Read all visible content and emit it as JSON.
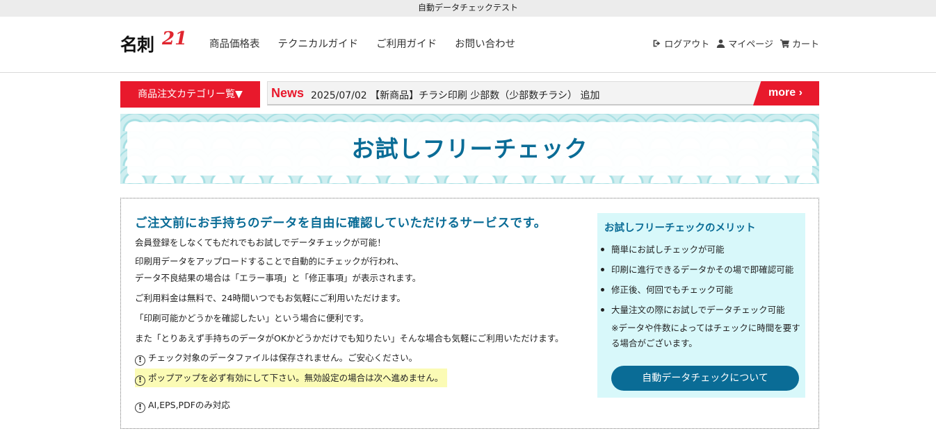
{
  "topbar": {
    "text": "自動データチェックテスト"
  },
  "header": {
    "logo_text": "名刺",
    "logo_number": "21",
    "nav": [
      "商品価格表",
      "テクニカルガイド",
      "ご利用ガイド",
      "お問い合わせ"
    ],
    "user": {
      "logout": "ログアウト",
      "mypage": "マイページ",
      "cart": "カート"
    },
    "icons": [
      "logout-icon",
      "user-icon",
      "cart-icon"
    ]
  },
  "category_button": "商品注文カテゴリー覧▼",
  "news": {
    "label": "News",
    "text": "2025/07/02 【新商品】チラシ印刷 少部数（少部数チラシ） 追加",
    "more": "more ›"
  },
  "banner": {
    "title": "お試しフリーチェック"
  },
  "main": {
    "lead": "ご注文前にお手持ちのデータを自由に確認していただけるサービスです。",
    "p1": "会員登録をしなくてもだれでもお試しでデータチェックが可能！",
    "p2a": "印刷用データをアップロードすることで自動的にチェックが行われ、",
    "p2b": "データ不良結果の場合は「エラー事項」と「修正事項」が表示されます。",
    "p3": "ご利用料金は無料で、24時間いつでもお気軽にご利用いただけます。",
    "p4": "「印刷可能かどうかを確認したい」という場合に便利です。",
    "p5": "また「とりあえず手持ちのデータがOKかどうかだけでも知りたい」そんな場合も気軽にご利用いただけます。",
    "warn1": "チェック対象のデータファイルは保存されません。ご安心ください。",
    "warn2": "ポップアップを必ず有効にして下さい。無効設定の場合は次へ進めません。",
    "warn3": "AI,EPS,PDFのみ対応",
    "warn_icon": "!"
  },
  "merit": {
    "title": "お試しフリーチェックのメリット",
    "items": [
      "簡単にお試しチェックが可能",
      "印刷に進行できるデータかその場で即確認可能",
      "修正後、何回でもチェック可能",
      "大量注文の際にお試しでデータチェック可能"
    ],
    "note": "※データや件数によってはチェックに時間を要する場合がございます。",
    "button": "自動データチェックについて"
  },
  "colors": {
    "accent_red": "#e8192c",
    "brand_blue": "#0a6c96",
    "highlight": "#fbfbb5",
    "merit_bg": "#d8f8fa"
  }
}
